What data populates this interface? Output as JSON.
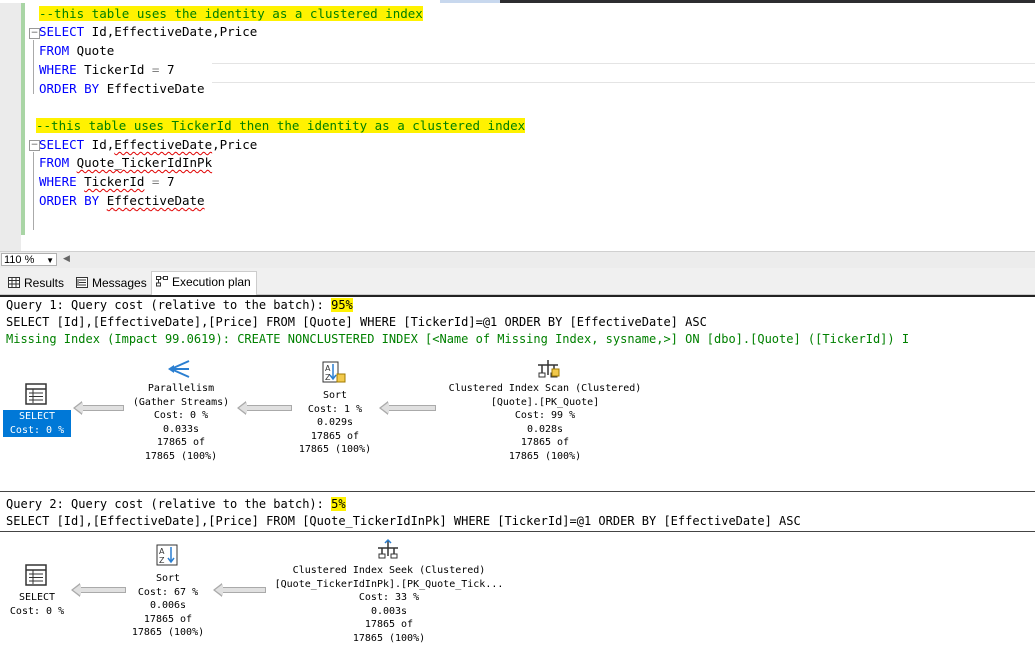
{
  "editor": {
    "lines": {
      "c1": "--this table uses the identity as a clustered index",
      "l2_kw": "SELECT",
      "l2_rest": " Id,EffectiveDate,Price",
      "l3_kw": "FROM",
      "l3_rest": " Quote",
      "l4_kw": "WHERE",
      "l4_rest": " TickerId ",
      "l4_op": "=",
      "l4_val": " 7",
      "l5_kw": "ORDER BY",
      "l5_rest": " EffectiveDate",
      "c2": "--this table uses TickerId then the identity as a clustered index",
      "l8_kw": "SELECT",
      "l8_a": " Id,",
      "l8_b": "EffectiveDate",
      "l8_c": ",Price",
      "l9_kw": "FROM",
      "l9_a": " ",
      "l9_b": "Quote_TickerIdInPk",
      "l10_kw": "WHERE",
      "l10_a": " ",
      "l10_b": "TickerId",
      "l10_op": " =",
      "l10_val": " 7",
      "l11_kw": "ORDER BY",
      "l11_a": " ",
      "l11_b": "EffectiveDate"
    }
  },
  "zoom": {
    "value": "110 %"
  },
  "tabs": {
    "results": "Results",
    "messages": "Messages",
    "execution_plan": "Execution plan"
  },
  "query1": {
    "header_prefix": "Query 1: Query cost (relative to the batch): ",
    "cost_pct": "95%",
    "statement": "SELECT [Id],[EffectiveDate],[Price] FROM [Quote] WHERE [TickerId]=@1 ORDER BY [EffectiveDate] ASC",
    "missing_index": "Missing Index (Impact 99.0619): CREATE NONCLUSTERED INDEX [<Name of Missing Index, sysname,>] ON [dbo].[Quote] ([TickerId]) I",
    "select_node": "SELECT\nCost: 0 %",
    "parallelism_node": "Parallelism\n(Gather Streams)\nCost: 0 %\n0.033s\n17865 of\n17865 (100%)",
    "sort_node": "Sort\nCost: 1 %\n0.029s\n17865 of\n17865 (100%)",
    "scan_node": "Clustered Index Scan (Clustered)\n[Quote].[PK_Quote]\nCost: 99 %\n0.028s\n17865 of\n17865 (100%)"
  },
  "query2": {
    "header_prefix": "Query 2: Query cost (relative to the batch): ",
    "cost_pct": "5%",
    "statement": "SELECT [Id],[EffectiveDate],[Price] FROM [Quote_TickerIdInPk] WHERE [TickerId]=@1 ORDER BY [EffectiveDate] ASC",
    "select_node": "SELECT\nCost: 0 %",
    "sort_node": "Sort\nCost: 67 %\n0.006s\n17865 of\n17865 (100%)",
    "seek_node": "Clustered Index Seek (Clustered)\n[Quote_TickerIdInPk].[PK_Quote_Tick...\nCost: 33 %\n0.003s\n17865 of\n17865 (100%)"
  },
  "colors": {
    "keyword": "#0000ff",
    "comment": "#008000",
    "highlight": "#fff200",
    "selected_node": "#0078d7"
  },
  "icons": [
    "select-icon",
    "parallelism-icon",
    "sort-icon",
    "clustered-index-scan-icon",
    "clustered-index-seek-icon",
    "results-grid-icon",
    "messages-icon",
    "execution-plan-icon"
  ]
}
